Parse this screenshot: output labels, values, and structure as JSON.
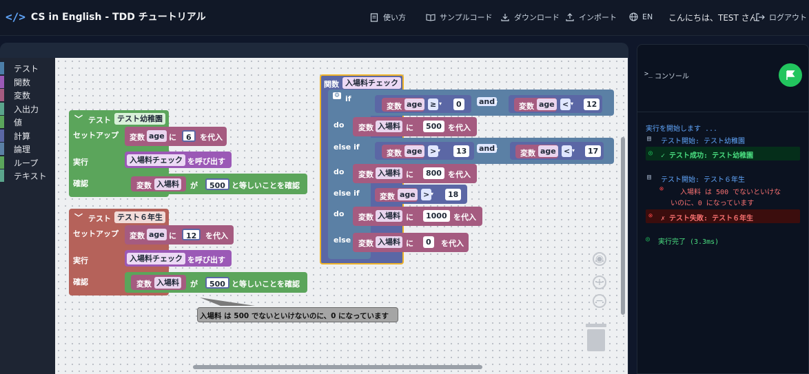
{
  "header": {
    "logo_glyph": "</>",
    "app_title": "CS in English - TDD チュートリアル",
    "nav": {
      "howto": "使い方",
      "sample": "サンプルコード",
      "download": "ダウンロード",
      "import": "インポート",
      "language": "EN",
      "greeting": "こんにちは、TEST さん",
      "logout": "ログアウト"
    }
  },
  "toolbox": {
    "items": [
      {
        "label": "テスト",
        "color": "#4c7ea8"
      },
      {
        "label": "関数",
        "color": "#9b59b6"
      },
      {
        "label": "変数",
        "color": "#a55b80"
      },
      {
        "label": "入出力",
        "color": "#5ba58c"
      },
      {
        "label": "値",
        "color": "#5ba55b"
      },
      {
        "label": "計算",
        "color": "#5b67a5"
      },
      {
        "label": "論理",
        "color": "#5b80a5"
      },
      {
        "label": "ループ",
        "color": "#5ba55b"
      },
      {
        "label": "テキスト",
        "color": "#5ba58c"
      }
    ]
  },
  "blocks": {
    "test1": {
      "kw": "テスト",
      "name": "テスト幼稚園",
      "setup": "セットアップ",
      "run": "実行",
      "check": "確認",
      "var_kw": "変数",
      "var": "age",
      "ni": "に",
      "val": "6",
      "assign": "を代入",
      "call_name": "入場料チェック",
      "call_suffix": "を呼び出す",
      "assert_var": "入場料",
      "ga": "が",
      "assert_val": "500",
      "assert_suffix": "と等しいことを確認"
    },
    "test2": {
      "kw": "テスト",
      "name": "テスト６年生",
      "setup": "セットアップ",
      "run": "実行",
      "check": "確認",
      "var_kw": "変数",
      "var": "age",
      "ni": "に",
      "val": "12",
      "assign": "を代入",
      "call_name": "入場料チェック",
      "call_suffix": "を呼び出す",
      "assert_var": "入場料",
      "ga": "が",
      "assert_val": "500",
      "assert_suffix": "と等しいことを確認"
    },
    "func": {
      "kw": "関数",
      "name": "入場料チェック",
      "if": "if",
      "do": "do",
      "elseif": "else if",
      "else": "else",
      "and": "and",
      "var_kw": "変数",
      "age": "age",
      "fee": "入場料",
      "ni": "に",
      "assign": "を代入",
      "op_ge": "≥",
      "op_lt": "<",
      "op_gt": ">",
      "c1a": "0",
      "c1b": "12",
      "c2a": "13",
      "c2b": "17",
      "c3": "18",
      "v1": "500",
      "v2": "800",
      "v3": "1000",
      "v4": "0"
    },
    "error_tooltip": "入場料 は 500 でないといけないのに、0 になっています"
  },
  "console": {
    "title": "コンソール",
    "lines": {
      "start": "実行を開始します ...",
      "t1_start": "テスト開始: テスト幼稚園",
      "t1_pass": "✓ テスト成功: テスト幼稚園",
      "t2_start": "テスト開始: テスト６年生",
      "t2_err1": "入場料 は 500 でないといけな",
      "t2_err2": "いのに、0 になっています",
      "t2_fail": "✗ テスト失敗: テスト６年生",
      "done": "実行完了 (3.3ms)"
    }
  }
}
